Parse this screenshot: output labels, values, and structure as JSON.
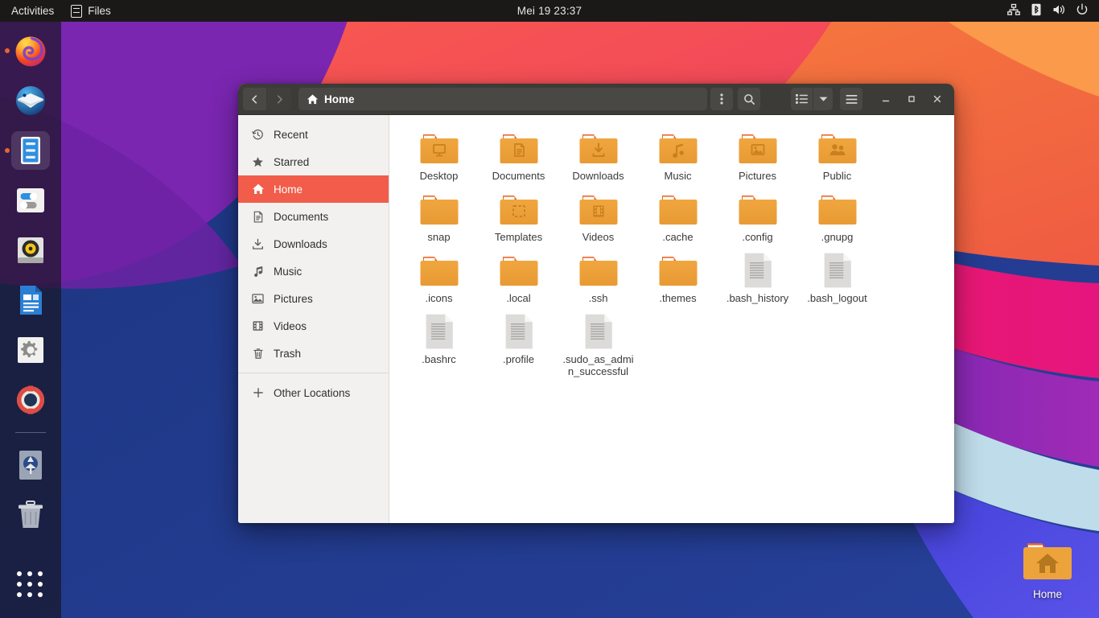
{
  "topbar": {
    "activities_label": "Activities",
    "app_label": "Files",
    "app_icon": "files-icon",
    "clock": "Mei 19  23:37",
    "indicators": [
      {
        "name": "network-icon",
        "label": "Network"
      },
      {
        "name": "bluetooth-icon",
        "label": "Bluetooth"
      },
      {
        "name": "volume-icon",
        "label": "Volume"
      },
      {
        "name": "power-icon",
        "label": "Power"
      }
    ]
  },
  "dock": {
    "items": [
      {
        "name": "dock-item-firefox",
        "label": "Firefox",
        "state": "running"
      },
      {
        "name": "dock-item-thunderbird",
        "label": "Thunderbird",
        "state": "idle"
      },
      {
        "name": "dock-item-files",
        "label": "Files",
        "state": "active"
      },
      {
        "name": "dock-item-settings",
        "label": "Settings",
        "state": "idle"
      },
      {
        "name": "dock-item-rhythmbox",
        "label": "Rhythmbox",
        "state": "idle"
      },
      {
        "name": "dock-item-libreoffice-writer",
        "label": "LibreOffice Writer",
        "state": "idle"
      },
      {
        "name": "dock-item-system-settings",
        "label": "System Settings",
        "state": "idle"
      },
      {
        "name": "dock-item-help",
        "label": "Help",
        "state": "idle"
      },
      {
        "name": "dock-item-ubuntu-software",
        "label": "Ubuntu Software",
        "state": "idle"
      },
      {
        "name": "dock-item-trash",
        "label": "Trash",
        "state": "idle"
      }
    ],
    "show_apps_label": "Show Applications"
  },
  "desktop": {
    "icons": [
      {
        "name": "desktop-icon-home",
        "label": "Home",
        "type": "home-folder"
      }
    ]
  },
  "window": {
    "title": "Home",
    "nav": {
      "back_label": "Back",
      "forward_label": "Forward"
    },
    "pathbar": {
      "location": "Home",
      "icon": "home-icon"
    },
    "buttons": {
      "menu_label": "Options",
      "search_label": "Search",
      "view_grid_label": "Grid view",
      "view_dropdown_label": "View options",
      "hamburger_label": "Main menu",
      "minimize_label": "Minimize",
      "maximize_label": "Maximize",
      "close_label": "Close"
    },
    "sidebar": {
      "items": [
        {
          "label": "Recent",
          "icon": "clock-icon",
          "selected": false
        },
        {
          "label": "Starred",
          "icon": "star-icon",
          "selected": false
        },
        {
          "label": "Home",
          "icon": "home-icon",
          "selected": true
        },
        {
          "label": "Documents",
          "icon": "document-icon",
          "selected": false
        },
        {
          "label": "Downloads",
          "icon": "download-icon",
          "selected": false
        },
        {
          "label": "Music",
          "icon": "music-note-icon",
          "selected": false
        },
        {
          "label": "Pictures",
          "icon": "image-icon",
          "selected": false
        },
        {
          "label": "Videos",
          "icon": "film-icon",
          "selected": false
        },
        {
          "label": "Trash",
          "icon": "trash-icon",
          "selected": false
        }
      ],
      "other_locations": {
        "label": "Other Locations",
        "icon": "plus-icon"
      }
    },
    "files": [
      {
        "name": "Desktop",
        "type": "folder",
        "emblem": "desktop-emblem"
      },
      {
        "name": "Documents",
        "type": "folder",
        "emblem": "document-emblem"
      },
      {
        "name": "Downloads",
        "type": "folder",
        "emblem": "download-emblem"
      },
      {
        "name": "Music",
        "type": "folder",
        "emblem": "music-emblem"
      },
      {
        "name": "Pictures",
        "type": "folder",
        "emblem": "image-emblem"
      },
      {
        "name": "Public",
        "type": "folder",
        "emblem": "people-emblem"
      },
      {
        "name": "snap",
        "type": "folder",
        "emblem": "none"
      },
      {
        "name": "Templates",
        "type": "folder",
        "emblem": "templates-emblem"
      },
      {
        "name": "Videos",
        "type": "folder",
        "emblem": "film-emblem"
      },
      {
        "name": ".cache",
        "type": "folder",
        "emblem": "none"
      },
      {
        "name": ".config",
        "type": "folder",
        "emblem": "none"
      },
      {
        "name": ".gnupg",
        "type": "folder",
        "emblem": "none"
      },
      {
        "name": ".icons",
        "type": "folder",
        "emblem": "none"
      },
      {
        "name": ".local",
        "type": "folder",
        "emblem": "none"
      },
      {
        "name": ".ssh",
        "type": "folder",
        "emblem": "none"
      },
      {
        "name": ".themes",
        "type": "folder",
        "emblem": "none"
      },
      {
        "name": ".bash_history",
        "type": "text-file",
        "emblem": "none"
      },
      {
        "name": ".bash_logout",
        "type": "text-file",
        "emblem": "none"
      },
      {
        "name": ".bashrc",
        "type": "text-file",
        "emblem": "none"
      },
      {
        "name": ".profile",
        "type": "text-file",
        "emblem": "none"
      },
      {
        "name": ".sudo_as_admin_successful",
        "type": "text-file",
        "emblem": "none"
      }
    ]
  },
  "colors": {
    "accent": "#f15d4a",
    "folder": "#e9a33a",
    "folder_dark": "#e8862b",
    "topbar_bg": "#1b1918",
    "headerbar_bg": "#3c3b37",
    "sidebar_bg": "#f2f1f0",
    "dock_bg": "#171421"
  }
}
